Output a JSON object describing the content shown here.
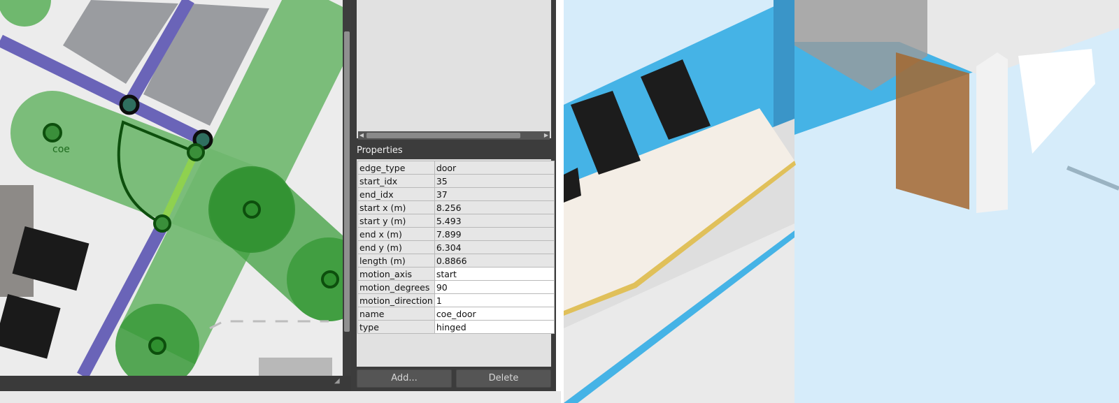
{
  "map": {
    "vertex_label": "coe",
    "colors": {
      "wall": "#6a64b8",
      "lane_light": "#6fb86e",
      "lane_dark": "#2f8f2f",
      "vertex": "#1e6b1e",
      "door": "#8fd14f",
      "building": "#9a9ca0"
    }
  },
  "list": {
    "scroll_left_icon": "arrow-left-icon",
    "scroll_right_icon": "arrow-right-icon"
  },
  "properties": {
    "title": "Properties",
    "rows": [
      {
        "key": "edge_type",
        "value": "door",
        "editable": false
      },
      {
        "key": "start_idx",
        "value": "35",
        "editable": false
      },
      {
        "key": "end_idx",
        "value": "37",
        "editable": false
      },
      {
        "key": "start x (m)",
        "value": "8.256",
        "editable": false
      },
      {
        "key": "start y (m)",
        "value": "5.493",
        "editable": false
      },
      {
        "key": "end x (m)",
        "value": "7.899",
        "editable": false
      },
      {
        "key": "end y (m)",
        "value": "6.304",
        "editable": false
      },
      {
        "key": "length (m)",
        "value": "0.8866",
        "editable": false
      },
      {
        "key": "motion_axis",
        "value": "start",
        "editable": true
      },
      {
        "key": "motion_degrees",
        "value": "90",
        "editable": true
      },
      {
        "key": "motion_direction",
        "value": "1",
        "editable": true
      },
      {
        "key": "name",
        "value": "coe_door",
        "editable": true
      },
      {
        "key": "type",
        "value": "hinged",
        "editable": true
      }
    ]
  },
  "buttons": {
    "add": "Add...",
    "delete": "Delete"
  },
  "view3d": {
    "colors": {
      "floor": "#d6ecfa",
      "wall_blue": "#45b3e6",
      "wall_white": "#eaeaea",
      "door": "#a4672f",
      "chair": "#1c1c1c",
      "table": "#f4eee6"
    }
  }
}
